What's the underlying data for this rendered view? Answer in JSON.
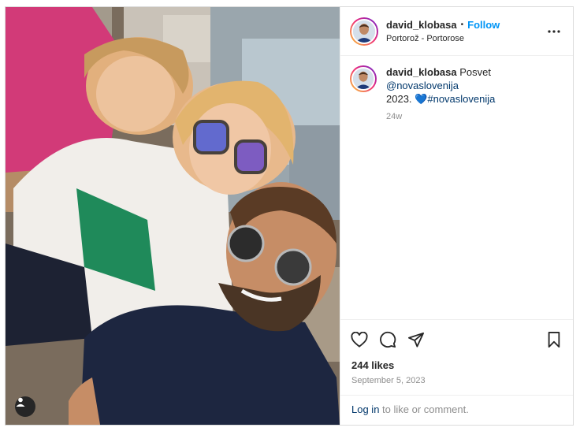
{
  "post": {
    "username": "david_klobasa",
    "separator": "•",
    "follow_label": "Follow",
    "location": "Portorož - Portorose",
    "caption": {
      "username": "david_klobasa",
      "text_start": "Posvet ",
      "mention": "@novaslovenija",
      "text_year": "2023.",
      "heart_emoji": "💙",
      "hashtag": "#novaslovenija",
      "age": "24w"
    },
    "likes": "244 likes",
    "date": "September 5, 2023",
    "login_link": "Log in",
    "login_rest": " to like or comment."
  },
  "colors": {
    "accent": "#0095f6",
    "link": "#00376b",
    "muted": "#8e8e8e",
    "border": "#dbdbdb"
  },
  "icons": {
    "more": "more-options-icon",
    "like": "heart-icon",
    "comment": "comment-icon",
    "share": "share-icon",
    "save": "bookmark-icon",
    "tag": "user-tag-icon"
  }
}
